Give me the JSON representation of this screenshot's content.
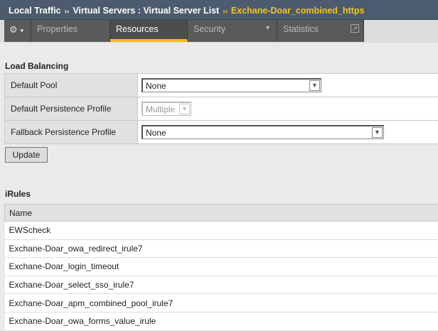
{
  "breadcrumb": {
    "items": [
      "Local Traffic",
      "Virtual Servers : Virtual Server List"
    ],
    "current": "Exchane-Doar_combined_https",
    "separator": "››"
  },
  "tabs": [
    {
      "label": "Properties"
    },
    {
      "label": "Resources",
      "active": true
    },
    {
      "label": "Security"
    },
    {
      "label": "Statistics"
    }
  ],
  "load_balancing": {
    "title": "Load Balancing",
    "rows": [
      {
        "label": "Default Pool",
        "value": "None"
      },
      {
        "label": "Default Persistence Profile",
        "value": "Multiple"
      },
      {
        "label": "Fallback Persistence Profile",
        "value": "None"
      }
    ],
    "update_label": "Update"
  },
  "irules": {
    "title": "iRules",
    "column": "Name",
    "items": [
      "EWScheck",
      "Exchane-Doar_owa_redirect_irule7",
      "Exchane-Doar_login_timeout",
      "Exchane-Doar_select_sso_irule7",
      "Exchane-Doar_apm_combined_pool_irule7",
      "Exchane-Doar_owa_forms_value_irule"
    ]
  }
}
